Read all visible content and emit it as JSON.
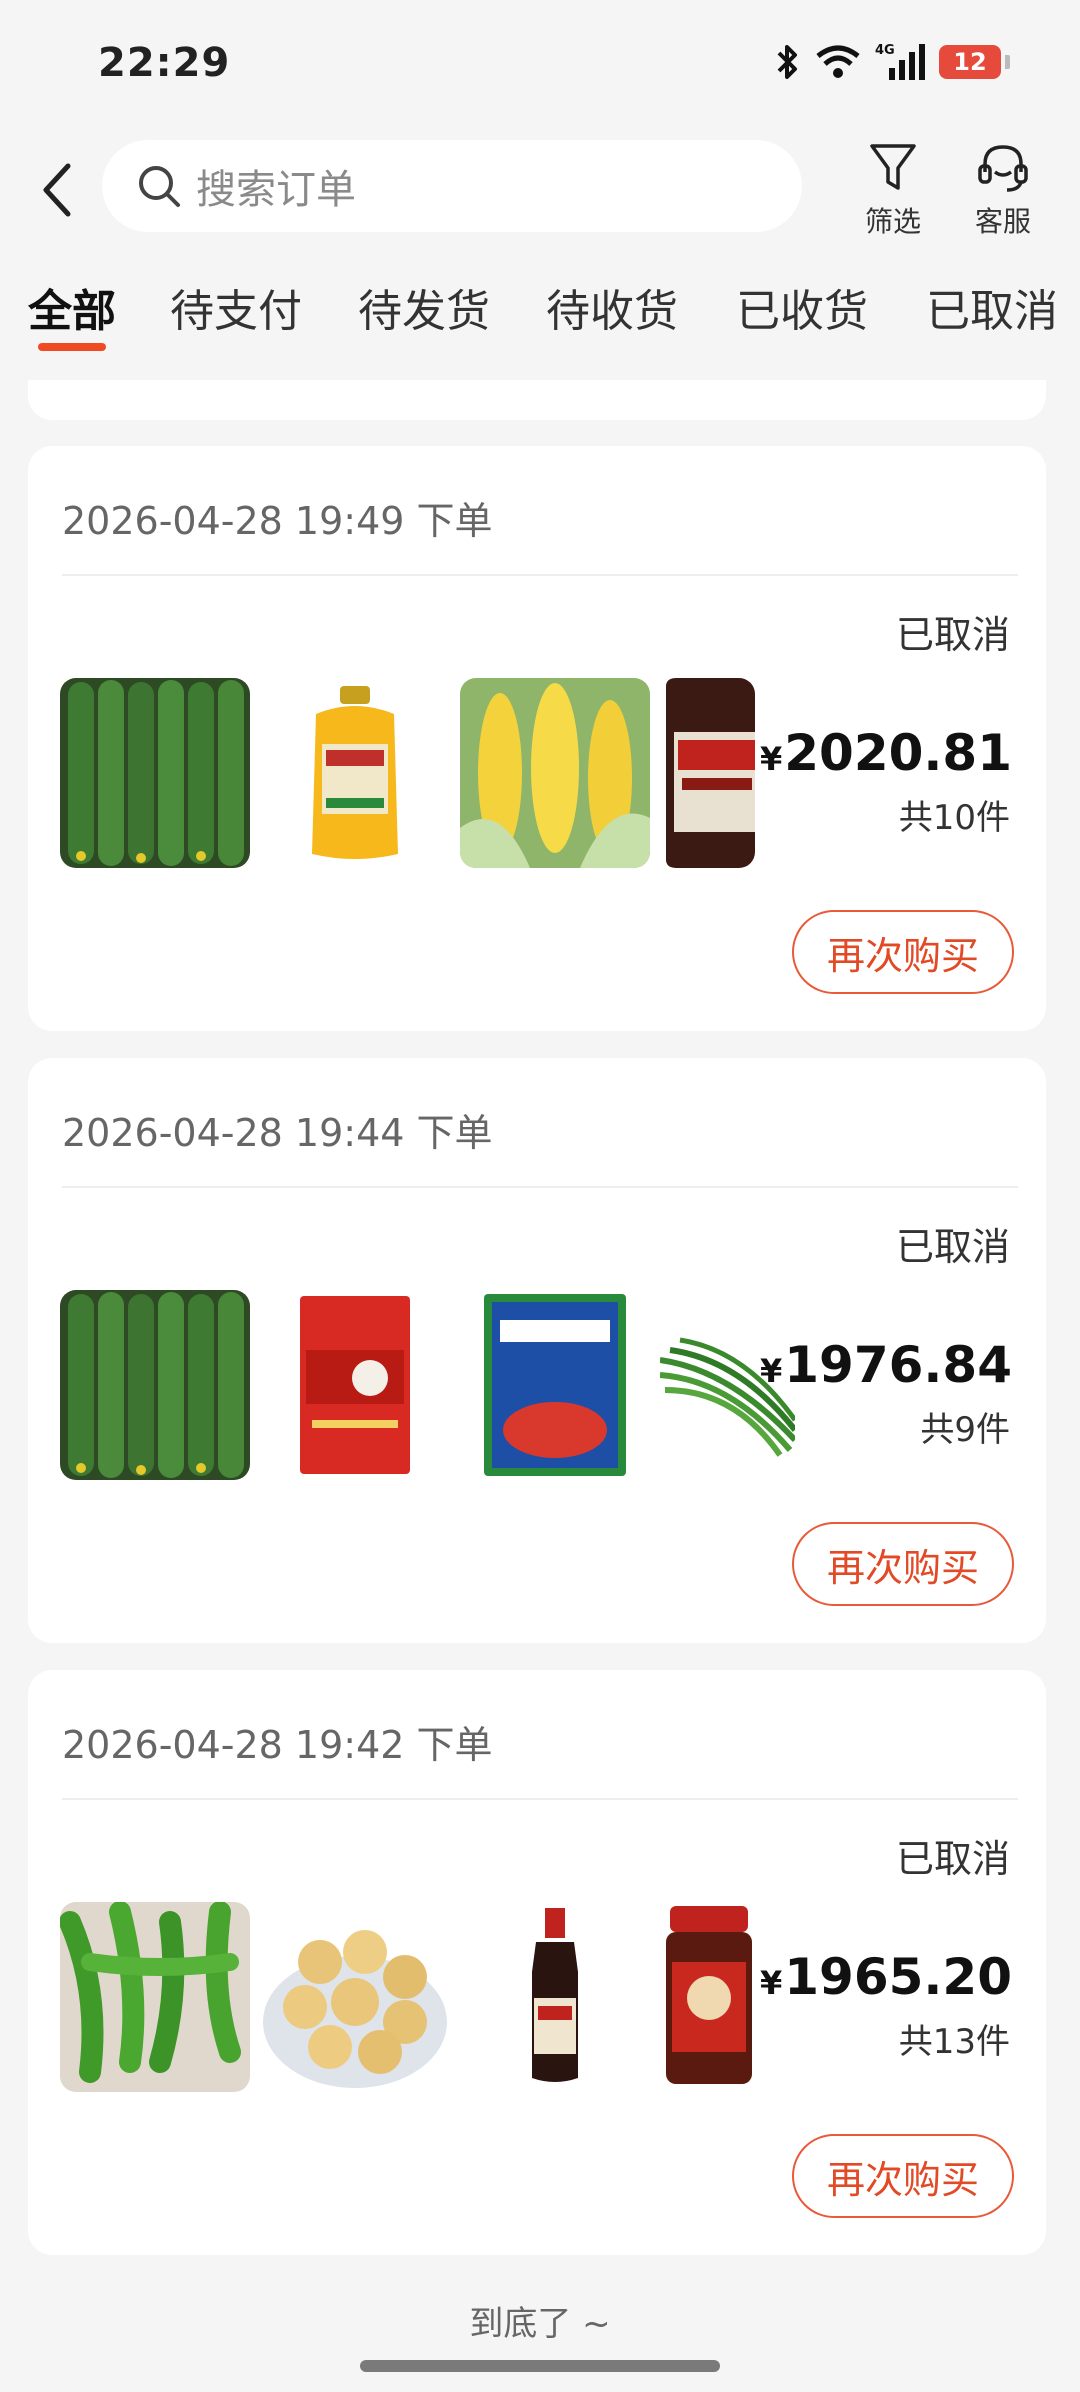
{
  "status_bar": {
    "time": "22:29",
    "battery": "12",
    "network": "4G"
  },
  "header": {
    "search_placeholder": "搜索订单",
    "filter_label": "筛选",
    "service_label": "客服"
  },
  "tabs": [
    {
      "label": "全部",
      "active": true
    },
    {
      "label": "待支付"
    },
    {
      "label": "待发货"
    },
    {
      "label": "待收货"
    },
    {
      "label": "已收货"
    },
    {
      "label": "已取消"
    }
  ],
  "orders": [
    {
      "time": "2026-04-28 19:49 下单",
      "status": "已取消",
      "currency": "¥",
      "amount": "2020.81",
      "count": "共10件",
      "action": "再次购买",
      "items": [
        "cucumber",
        "peanut-oil",
        "corn",
        "soy-sauce-haitian"
      ]
    },
    {
      "time": "2026-04-28 19:44 下单",
      "status": "已取消",
      "currency": "¥",
      "amount": "1976.84",
      "count": "共9件",
      "action": "再次购买",
      "items": [
        "cucumber",
        "hotpot-base-hong99",
        "chicken-essence",
        "chives"
      ]
    },
    {
      "time": "2026-04-28 19:42 下单",
      "status": "已取消",
      "currency": "¥",
      "amount": "1965.20",
      "count": "共13件",
      "action": "再次购买",
      "items": [
        "green-pepper",
        "tofu-puffs",
        "soy-sauce-bottle",
        "chili-sauce-jar"
      ]
    }
  ],
  "footer": "到底了 ~",
  "colors": {
    "accent": "#f04a25",
    "background": "#f5f5f5"
  }
}
